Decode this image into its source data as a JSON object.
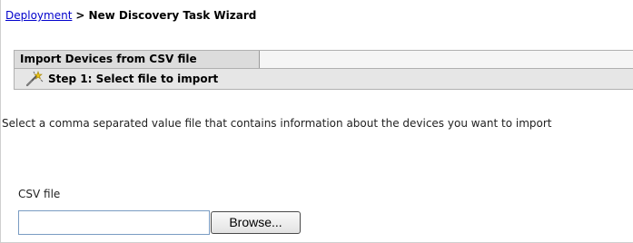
{
  "breadcrumb": {
    "parent_link": "Deployment",
    "separator": ">",
    "current": "New Discovery Task Wizard"
  },
  "tab": {
    "label": "Import Devices from CSV file"
  },
  "step": {
    "icon": "wand-icon",
    "title": "Step 1: Select file to import"
  },
  "description": "Select a comma separated value file that contains information about the devices you want to import",
  "csv_file": {
    "label": "CSV file",
    "value": "",
    "browse_label": "Browse..."
  }
}
